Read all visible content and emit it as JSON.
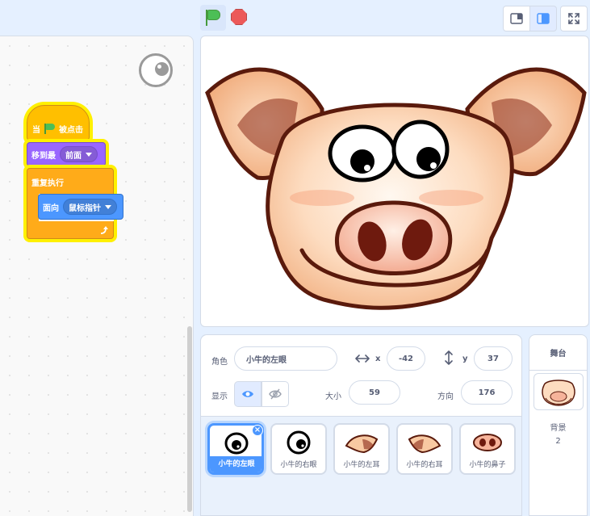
{
  "toolbar": {
    "green_flag_icon": "green-flag-icon",
    "stop_icon": "stop-icon"
  },
  "code": {
    "hat_when": "当",
    "hat_clicked": "被点击",
    "goto_label": "移到最",
    "goto_value": "前面",
    "forever_label": "重复执行",
    "point_label": "面向",
    "point_value": "鼠标指针"
  },
  "sprite_info": {
    "sprite_label": "角色",
    "sprite_name": "小牛的左眼",
    "x_label": "x",
    "x_value": "-42",
    "y_label": "y",
    "y_value": "37",
    "show_label": "显示",
    "size_label": "大小",
    "size_value": "59",
    "direction_label": "方向",
    "direction_value": "176"
  },
  "sprites": [
    {
      "name": "小牛的左眼",
      "selected": true
    },
    {
      "name": "小牛的右眼",
      "selected": false
    },
    {
      "name": "小牛的左耳",
      "selected": false
    },
    {
      "name": "小牛的右耳",
      "selected": false
    },
    {
      "name": "小牛的鼻子",
      "selected": false
    }
  ],
  "stage_pane": {
    "title": "舞台",
    "backdrop_label": "背景",
    "backdrop_count": "2"
  },
  "colors": {
    "events": "#ffbf00",
    "looks": "#9966ff",
    "control": "#ffab19",
    "motion": "#4c97ff",
    "glow": "#fff000"
  }
}
